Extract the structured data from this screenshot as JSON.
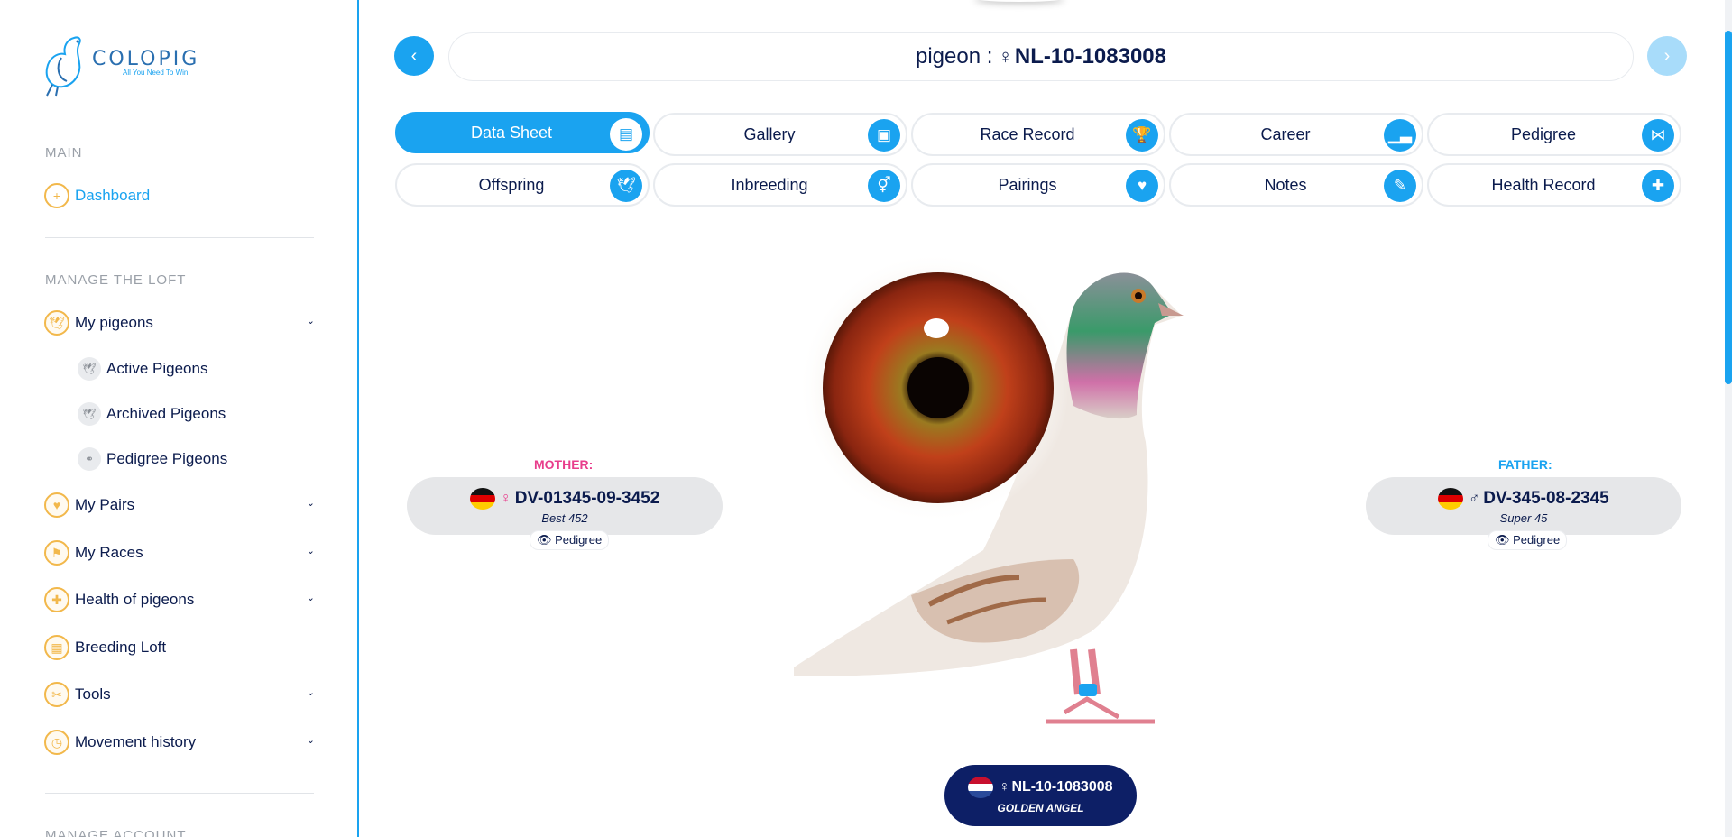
{
  "brand": {
    "name": "COLOPIG",
    "tagline": "All You Need To Win"
  },
  "sidebar": {
    "section_main": "MAIN",
    "dashboard": "Dashboard",
    "section_loft": "MANAGE THE LOFT",
    "my_pigeons": "My pigeons",
    "sub_items": [
      "Active Pigeons",
      "Archived Pigeons",
      "Pedigree Pigeons"
    ],
    "my_pairs": "My Pairs",
    "my_races": "My Races",
    "health": "Health of pigeons",
    "breeding": "Breeding Loft",
    "tools": "Tools",
    "movement": "Movement history",
    "section_account": "MANAGE ACCOUNT"
  },
  "header": {
    "prefix": "pigeon :",
    "sex_symbol": "♀",
    "ring": "NL-10-1083008"
  },
  "tabs": [
    {
      "label": "Data Sheet",
      "icon": "document-icon"
    },
    {
      "label": "Gallery",
      "icon": "image-icon"
    },
    {
      "label": "Race Record",
      "icon": "trophy-icon"
    },
    {
      "label": "Career",
      "icon": "career-chart-icon"
    },
    {
      "label": "Pedigree",
      "icon": "share-nodes-icon"
    },
    {
      "label": "Offspring",
      "icon": "dove-icon"
    },
    {
      "label": "Inbreeding",
      "icon": "gender-icon"
    },
    {
      "label": "Pairings",
      "icon": "pair-birds-icon"
    },
    {
      "label": "Notes",
      "icon": "notes-icon"
    },
    {
      "label": "Health Record",
      "icon": "health-file-icon"
    }
  ],
  "mother": {
    "role": "MOTHER:",
    "sex_symbol": "♀",
    "ring": "DV-01345-09-3452",
    "name": "Best 452",
    "pedigree": "Pedigree",
    "flag": "germany"
  },
  "father": {
    "role": "FATHER:",
    "sex_symbol": "♂",
    "ring": "DV-345-08-2345",
    "name": "Super 45",
    "pedigree": "Pedigree",
    "flag": "germany"
  },
  "current": {
    "sex_symbol": "♀",
    "ring": "NL-10-1083008",
    "name": "GOLDEN ANGEL",
    "flag": "netherlands"
  },
  "colors": {
    "accent": "#1aa3f0",
    "navy": "#0b1b4d",
    "badge": "#0d1f66",
    "mother": "#e83e8c",
    "icon_gold": "#f2b84b"
  }
}
